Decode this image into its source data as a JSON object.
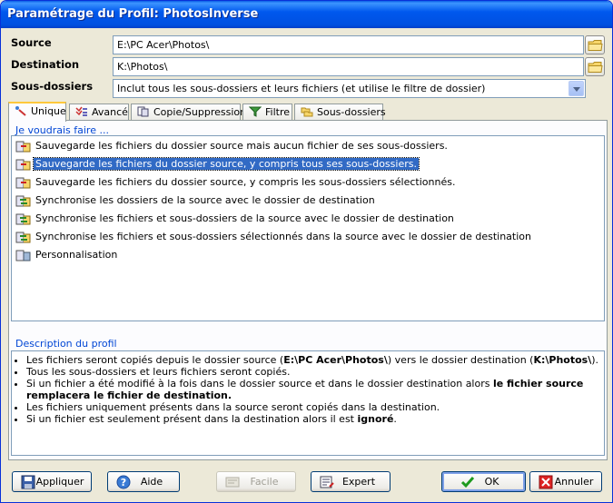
{
  "window": {
    "title": "Paramétrage du Profil: PhotosInverse"
  },
  "form": {
    "source_label": "Source",
    "source_value": "E:\\PC Acer\\Photos\\",
    "destination_label": "Destination",
    "destination_value": "K:\\Photos\\",
    "subfolders_label": "Sous-dossiers",
    "subfolders_selected": "Inclut tous les sous-dossiers et leurs fichiers (et utilise le filtre de dossier)"
  },
  "tabs": [
    {
      "label": "Unique",
      "icon": "unique-icon",
      "active": true
    },
    {
      "label": "Avancé",
      "icon": "advanced-icon"
    },
    {
      "label": "Copie/Suppression",
      "icon": "copy-delete-icon"
    },
    {
      "label": "Filtre",
      "icon": "filter-icon"
    },
    {
      "label": "Sous-dossiers",
      "icon": "subfolders-icon"
    }
  ],
  "panel": {
    "group_label": "Je voudrais faire ...",
    "options": [
      "Sauvegarde les fichiers du dossier source mais aucun fichier de ses sous-dossiers.",
      "Sauvegarde les fichiers du dossier source, y compris tous ses sous-dossiers.",
      "Sauvegarde les fichiers du dossier source, y compris les sous-dossiers sélectionnés.",
      "Synchronise les dossiers de la source avec le dossier de destination",
      "Synchronise les fichiers et sous-dossiers de la source avec le dossier de destination",
      "Synchronise les fichiers et sous-dossiers sélectionnés dans la source avec le dossier de destination",
      "Personnalisation"
    ],
    "selected_index": 1,
    "description_label": "Description du profil",
    "description": {
      "l1_a": "Les fichiers seront copiés depuis le dossier source (",
      "l1_b": "E:\\PC Acer\\Photos\\",
      "l1_c": ") vers le dossier destination (",
      "l1_d": "K:\\Photos\\",
      "l1_e": ").",
      "l2": "Tous les sous-dossiers et leurs fichiers seront copiés.",
      "l3_a": "Si un fichier a été modifié à la fois dans le dossier source et dans le dossier destination alors ",
      "l3_b": "le fichier source remplacera le fichier de destination.",
      "l4": "Les fichiers uniquement présents dans la source seront copiés dans la destination.",
      "l5_a": "Si un fichier est seulement présent dans la destination alors il est ",
      "l5_b": "ignoré",
      "l5_c": "."
    }
  },
  "buttons": {
    "apply": "Appliquer",
    "help": "Aide",
    "easy": "Facile",
    "expert": "Expert",
    "ok": "OK",
    "cancel": "Annuler"
  }
}
